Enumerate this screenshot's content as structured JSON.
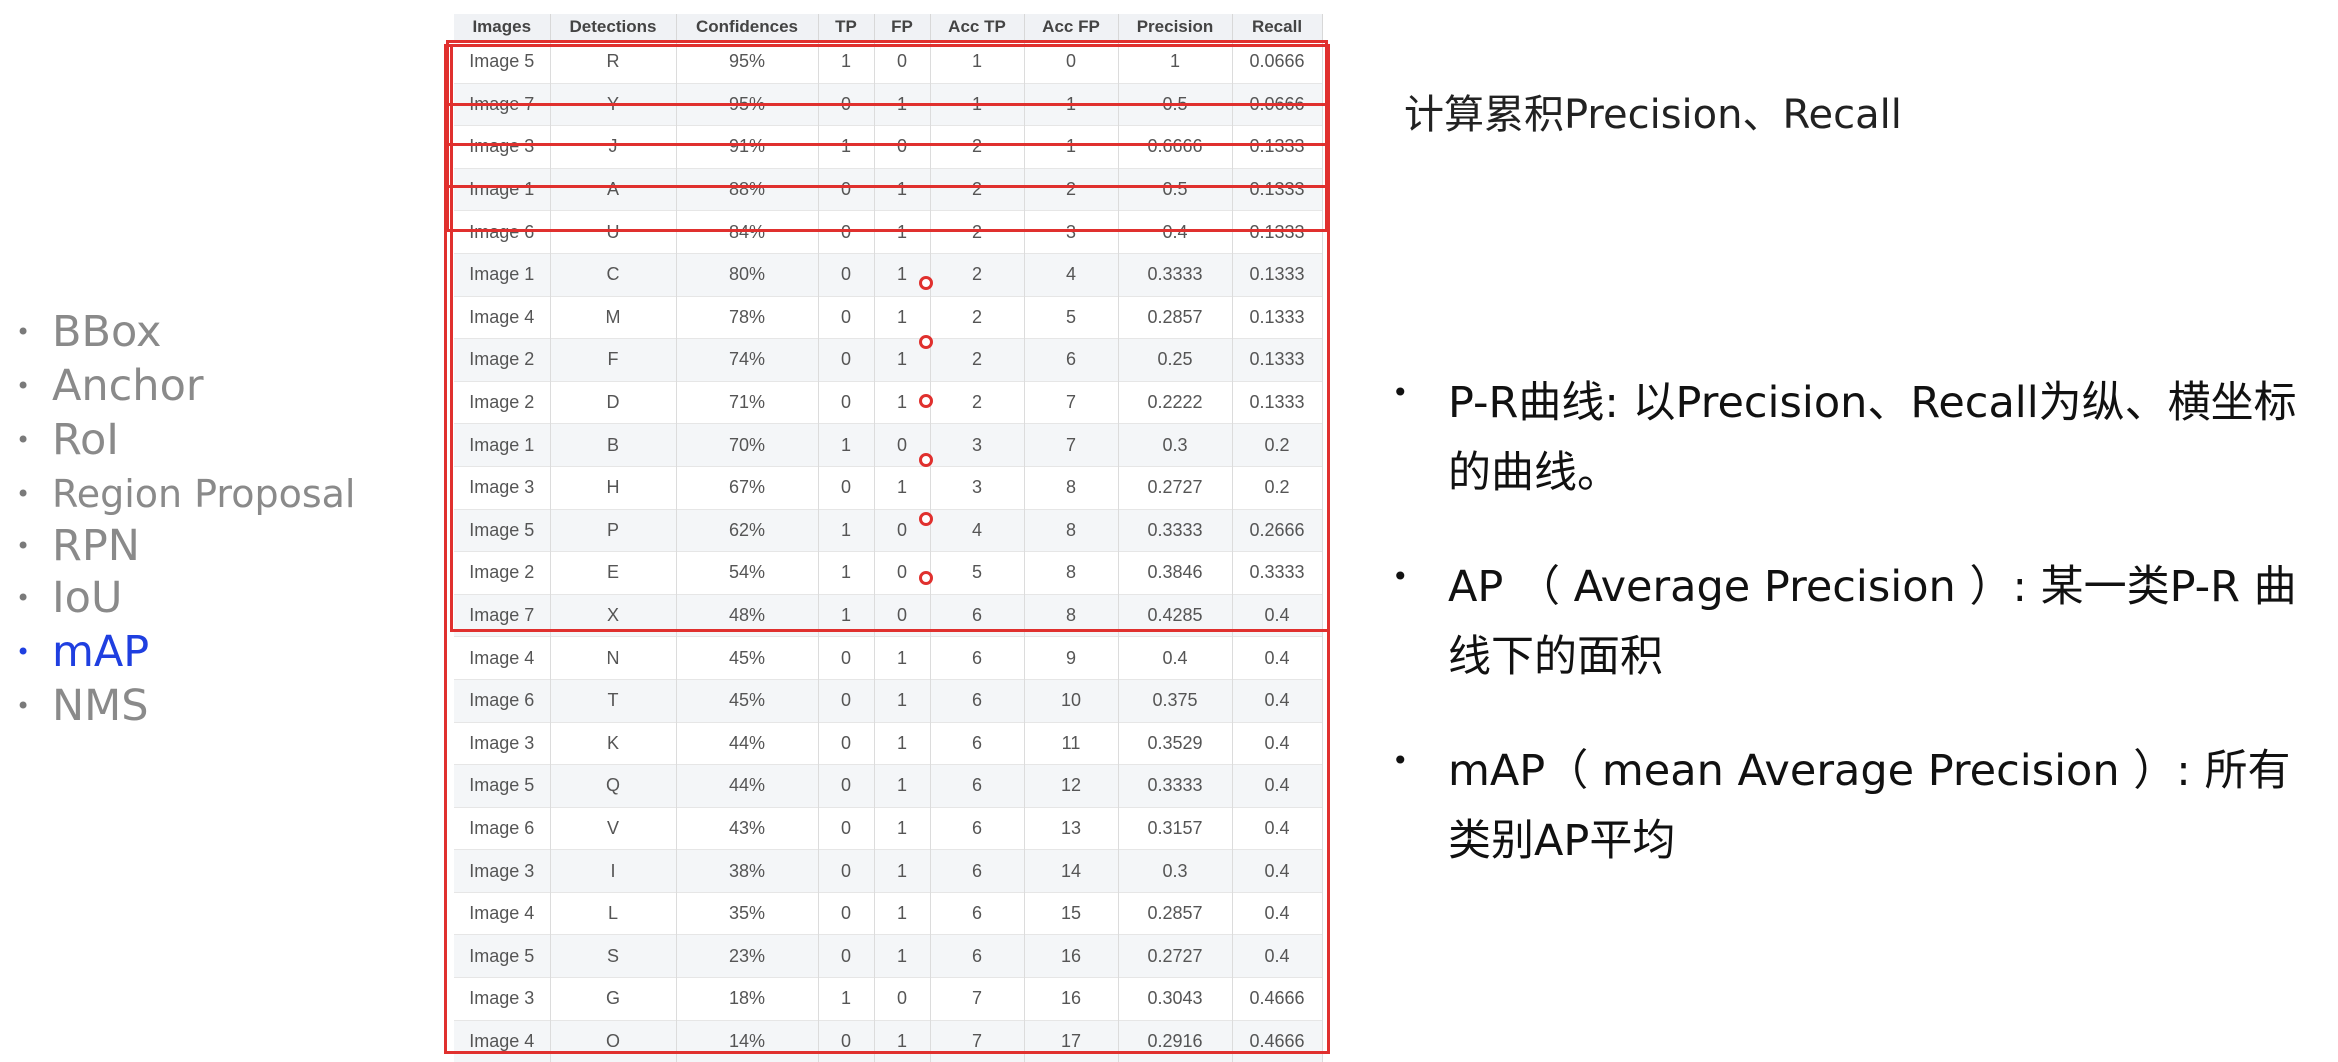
{
  "nav": {
    "items": [
      {
        "label": "BBox",
        "active": false
      },
      {
        "label": "Anchor",
        "active": false
      },
      {
        "label": "RoI",
        "active": false
      },
      {
        "label": "Region Proposal",
        "active": false
      },
      {
        "label": "RPN",
        "active": false
      },
      {
        "label": "IoU",
        "active": false
      },
      {
        "label": "mAP",
        "active": true
      },
      {
        "label": "NMS",
        "active": false
      }
    ],
    "bullet": "•",
    "active_color": "#1f3fe0",
    "inactive_color": "#8a8a8a"
  },
  "table": {
    "headers": [
      "Images",
      "Detections",
      "Confidences",
      "TP",
      "FP",
      "Acc TP",
      "Acc FP",
      "Precision",
      "Recall"
    ],
    "rows": [
      [
        "Image 5",
        "R",
        "95%",
        "1",
        "0",
        "1",
        "0",
        "1",
        "0.0666"
      ],
      [
        "Image 7",
        "Y",
        "95%",
        "0",
        "1",
        "1",
        "1",
        "0.5",
        "0.0666"
      ],
      [
        "Image 3",
        "J",
        "91%",
        "1",
        "0",
        "2",
        "1",
        "0.6666",
        "0.1333"
      ],
      [
        "Image 1",
        "A",
        "88%",
        "0",
        "1",
        "2",
        "2",
        "0.5",
        "0.1333"
      ],
      [
        "Image 6",
        "U",
        "84%",
        "0",
        "1",
        "2",
        "3",
        "0.4",
        "0.1333"
      ],
      [
        "Image 1",
        "C",
        "80%",
        "0",
        "1",
        "2",
        "4",
        "0.3333",
        "0.1333"
      ],
      [
        "Image 4",
        "M",
        "78%",
        "0",
        "1",
        "2",
        "5",
        "0.2857",
        "0.1333"
      ],
      [
        "Image 2",
        "F",
        "74%",
        "0",
        "1",
        "2",
        "6",
        "0.25",
        "0.1333"
      ],
      [
        "Image 2",
        "D",
        "71%",
        "0",
        "1",
        "2",
        "7",
        "0.2222",
        "0.1333"
      ],
      [
        "Image 1",
        "B",
        "70%",
        "1",
        "0",
        "3",
        "7",
        "0.3",
        "0.2"
      ],
      [
        "Image 3",
        "H",
        "67%",
        "0",
        "1",
        "3",
        "8",
        "0.2727",
        "0.2"
      ],
      [
        "Image 5",
        "P",
        "62%",
        "1",
        "0",
        "4",
        "8",
        "0.3333",
        "0.2666"
      ],
      [
        "Image 2",
        "E",
        "54%",
        "1",
        "0",
        "5",
        "8",
        "0.3846",
        "0.3333"
      ],
      [
        "Image 7",
        "X",
        "48%",
        "1",
        "0",
        "6",
        "8",
        "0.4285",
        "0.4"
      ],
      [
        "Image 4",
        "N",
        "45%",
        "0",
        "1",
        "6",
        "9",
        "0.4",
        "0.4"
      ],
      [
        "Image 6",
        "T",
        "45%",
        "0",
        "1",
        "6",
        "10",
        "0.375",
        "0.4"
      ],
      [
        "Image 3",
        "K",
        "44%",
        "0",
        "1",
        "6",
        "11",
        "0.3529",
        "0.4"
      ],
      [
        "Image 5",
        "Q",
        "44%",
        "0",
        "1",
        "6",
        "12",
        "0.3333",
        "0.4"
      ],
      [
        "Image 6",
        "V",
        "43%",
        "0",
        "1",
        "6",
        "13",
        "0.3157",
        "0.4"
      ],
      [
        "Image 3",
        "I",
        "38%",
        "0",
        "1",
        "6",
        "14",
        "0.3",
        "0.4"
      ],
      [
        "Image 4",
        "L",
        "35%",
        "0",
        "1",
        "6",
        "15",
        "0.2857",
        "0.4"
      ],
      [
        "Image 5",
        "S",
        "23%",
        "0",
        "1",
        "6",
        "16",
        "0.2727",
        "0.4"
      ],
      [
        "Image 3",
        "G",
        "18%",
        "1",
        "0",
        "7",
        "16",
        "0.3043",
        "0.4666"
      ],
      [
        "Image 4",
        "O",
        "14%",
        "0",
        "1",
        "7",
        "17",
        "0.2916",
        "0.4666"
      ]
    ],
    "highlight_color": "#e0302e"
  },
  "caption": "计算累积Precision、Recall",
  "bullets": {
    "dot": "•",
    "items": [
      "P-R曲线: 以Precision、Recall为纵、横坐标的曲线。",
      "AP （ Average Precision ）:  某一类P-R 曲线下的面积",
      "mAP（ mean Average Precision ）: 所有类别AP平均"
    ]
  }
}
